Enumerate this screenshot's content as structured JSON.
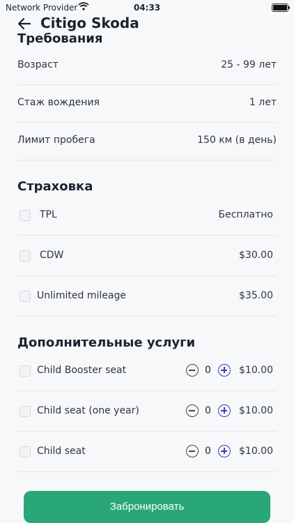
{
  "status": {
    "carrier": "Network Provider",
    "time": "04:33"
  },
  "header": {
    "title": "Citigo Skoda"
  },
  "requirements": {
    "title": "Требования",
    "rows": [
      {
        "label": "Возраст",
        "value": "25 - 99 лет"
      },
      {
        "label": "Стаж вождения",
        "value": "1 лет"
      },
      {
        "label": "Лимит пробега",
        "value": "150 км (в день)"
      }
    ]
  },
  "insurance": {
    "title": "Страховка",
    "rows": [
      {
        "label": "TPL",
        "price": "Бесплатно",
        "checked": false
      },
      {
        "label": "CDW",
        "price": "$30.00",
        "checked": false
      },
      {
        "label": "Unlimited mileage",
        "price": "$35.00",
        "checked": false
      }
    ]
  },
  "extras": {
    "title": "Дополнительные услуги",
    "rows": [
      {
        "label": "Child Booster seat",
        "qty": "0",
        "price": "$10.00",
        "checked": false
      },
      {
        "label": "Child seat (one year)",
        "qty": "0",
        "price": "$10.00",
        "checked": false
      },
      {
        "label": "Child seat",
        "qty": "0",
        "price": "$10.00",
        "checked": false
      }
    ]
  },
  "actions": {
    "book_label": "Забронировать"
  },
  "colors": {
    "accent": "#2aa776",
    "plus": "#3a3fb0",
    "text": "#1b2330"
  }
}
